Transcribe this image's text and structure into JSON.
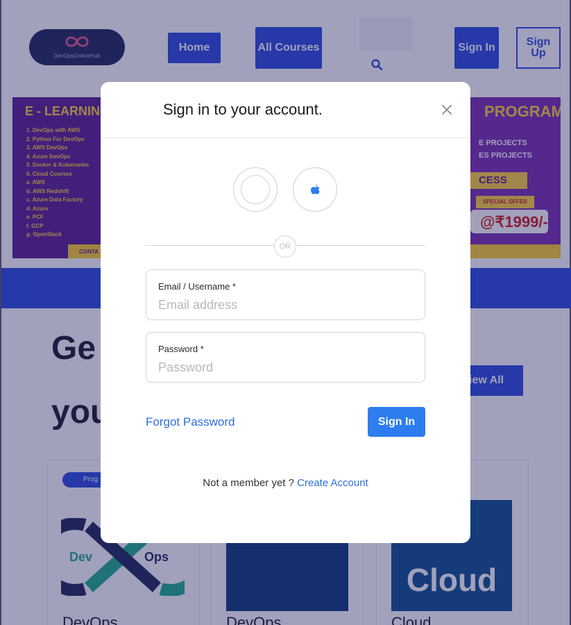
{
  "header": {
    "logo_text": "DevOpsOnlineHub",
    "nav": {
      "home": "Home",
      "all_courses": "All Courses",
      "sign_in": "Sign In",
      "sign_up": "Sign Up"
    }
  },
  "banner": {
    "left_title": "E - LEARNING",
    "list": [
      "1. DevOps with AWS",
      "2. Python For DevOps",
      "3. AWS DevOps",
      "4. Azure DevOps",
      "5. Docker & Kubernetes",
      "6. Cloud Courses",
      "   a. AWS",
      "   b. AWS Redshift",
      "   c. Azure Data Factory",
      "   d. Azure",
      "   e. PCF",
      "   f. GCP",
      "   g. OpenStack"
    ],
    "contact_label": "CONTA",
    "program_title": "PROGRAM",
    "projects_line1": "E PROJECTS",
    "projects_line2": "ES PROJECTS",
    "access_label": "CESS",
    "special_offer": "SPECIAL OFFER",
    "price": "@₹1999/-"
  },
  "section": {
    "heading_line1": "Ge",
    "heading_line2": "you",
    "view_all_label": "iew All"
  },
  "cards": [
    {
      "tag": "Prog",
      "title": "DevOps",
      "image_text_left": "Dev",
      "image_text_right": "Ops"
    },
    {
      "title": "DevOps"
    },
    {
      "title": "Cloud",
      "image_text": "Cloud"
    }
  ],
  "modal": {
    "title": "Sign in to your account.",
    "or_label": "OR",
    "email_label": "Email / Username *",
    "email_placeholder": "Email address",
    "password_label": "Password *",
    "password_placeholder": "Password",
    "forgot_password": "Forgot Password",
    "sign_in_button": "Sign In",
    "member_text": "Not a member yet ? ",
    "create_account": "Create Account"
  },
  "colors": {
    "accent": "#2d4be0",
    "sign_in_button": "#2d7df0",
    "link": "#2d6fd8",
    "overlay": "#1e205c"
  },
  "icons": [
    "close-icon",
    "google-icon",
    "apple-icon",
    "search-icon",
    "logo-icon"
  ]
}
